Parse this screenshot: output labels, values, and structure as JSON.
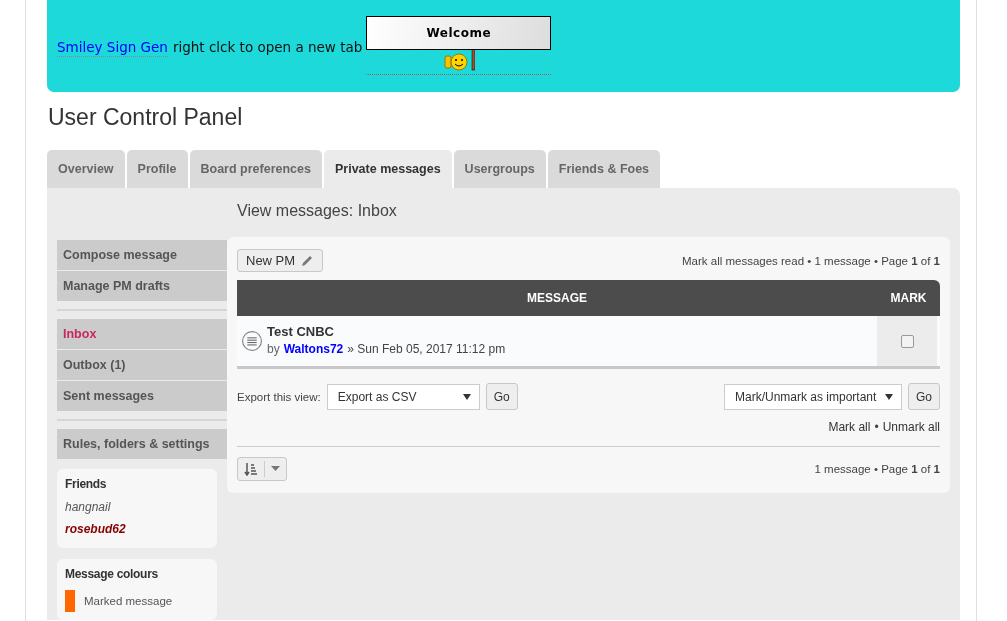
{
  "banner": {
    "link": "Smiley Sign Gen",
    "text": "right clck to open a new tab",
    "sign_text": "Welcome"
  },
  "page_title": "User Control Panel",
  "tabs": [
    {
      "label": "Overview",
      "selected": false
    },
    {
      "label": "Profile",
      "selected": false
    },
    {
      "label": "Board preferences",
      "selected": false
    },
    {
      "label": "Private messages",
      "selected": true
    },
    {
      "label": "Usergroups",
      "selected": false
    },
    {
      "label": "Friends & Foes",
      "selected": false
    }
  ],
  "sidebar": {
    "groups": [
      [
        {
          "label": "Compose message",
          "selected": false
        },
        {
          "label": "Manage PM drafts",
          "selected": false
        }
      ],
      [
        {
          "label": "Inbox",
          "selected": true
        },
        {
          "label": "Outbox (1)",
          "selected": false
        },
        {
          "label": "Sent messages",
          "selected": false
        }
      ],
      [
        {
          "label": "Rules, folders & settings",
          "selected": false
        }
      ]
    ],
    "friends": {
      "title": "Friends",
      "items": [
        {
          "name": "hangnail",
          "online": false
        },
        {
          "name": "rosebud62",
          "online": true
        }
      ]
    },
    "colours": {
      "title": "Message colours",
      "items": [
        {
          "label": "Marked message",
          "color": "#ff6600"
        }
      ]
    }
  },
  "main": {
    "heading": "View messages: Inbox",
    "new_pm": "New PM",
    "top_info": "Mark all messages read • 1 message • Page **1** of **1**",
    "table": {
      "columns": [
        "MESSAGE",
        "MARK"
      ],
      "rows": [
        {
          "subject": "Test CNBC",
          "by": "by",
          "author": "Waltons72",
          "date": "» Sun Feb 05, 2017 11:12 pm",
          "checked": false
        }
      ]
    },
    "export_label": "Export this view:",
    "export_value": "Export as CSV",
    "go": "Go",
    "action_value": "Mark/Unmark as important",
    "go2": "Go",
    "mark_all": "Mark all",
    "sep": "•",
    "unmark_all": "Unmark all",
    "bottom_info": "1 message • Page **1** of **1**"
  }
}
